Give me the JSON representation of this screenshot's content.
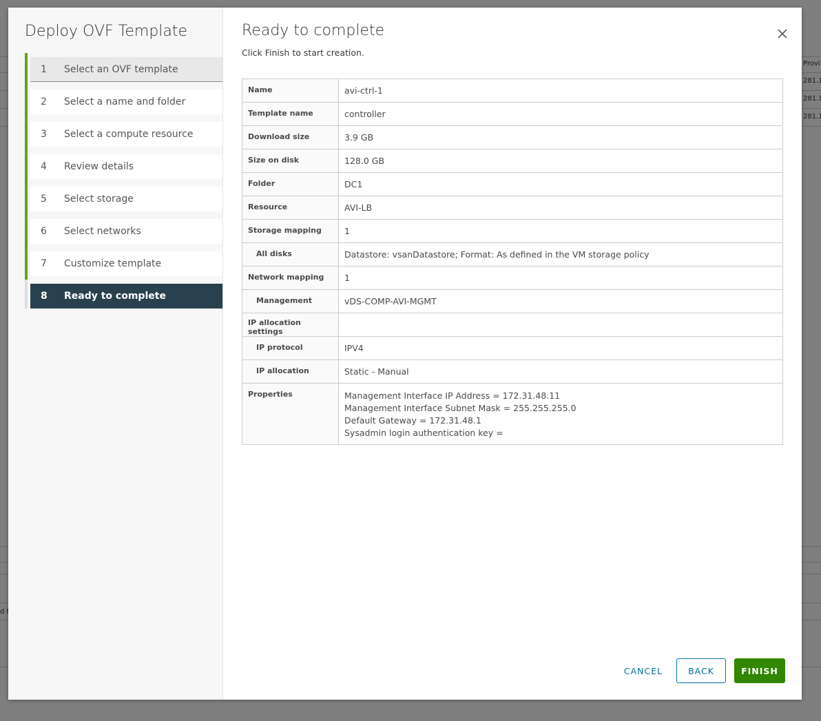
{
  "background": {
    "column_header": "Provi",
    "cells": [
      "281.1",
      "281.1",
      "281.1"
    ],
    "lower_text": "d F"
  },
  "wizard": {
    "title": "Deploy OVF Template",
    "steps": [
      {
        "num": "1",
        "label": "Select an OVF template"
      },
      {
        "num": "2",
        "label": "Select a name and folder"
      },
      {
        "num": "3",
        "label": "Select a compute resource"
      },
      {
        "num": "4",
        "label": "Review details"
      },
      {
        "num": "5",
        "label": "Select storage"
      },
      {
        "num": "6",
        "label": "Select networks"
      },
      {
        "num": "7",
        "label": "Customize template"
      },
      {
        "num": "8",
        "label": "Ready to complete"
      }
    ],
    "active_step": 8,
    "accent_color": "#62a420",
    "active_bg": "#29414e"
  },
  "page": {
    "title": "Ready to complete",
    "subtitle": "Click Finish to start creation.",
    "close_icon": "close-icon"
  },
  "summary": [
    {
      "key": "Name",
      "value": "avi-ctrl-1"
    },
    {
      "key": "Template name",
      "value": "controller"
    },
    {
      "key": "Download size",
      "value": "3.9 GB"
    },
    {
      "key": "Size on disk",
      "value": "128.0 GB"
    },
    {
      "key": "Folder",
      "value": "DC1"
    },
    {
      "key": "Resource",
      "value": "AVI-LB"
    },
    {
      "key": "Storage mapping",
      "value": "1"
    },
    {
      "key": "All disks",
      "value": "Datastore: vsanDatastore; Format: As defined in the VM storage policy"
    },
    {
      "key": "Network mapping",
      "value": "1"
    },
    {
      "key": "Management",
      "value": "vDS-COMP-AVI-MGMT"
    },
    {
      "key": "IP allocation settings",
      "value": ""
    },
    {
      "key": "IP protocol",
      "value": "IPV4"
    },
    {
      "key": "IP allocation",
      "value": "Static - Manual"
    },
    {
      "key": "Properties",
      "lines": [
        "Management Interface IP Address = 172.31.48.11",
        "Management Interface Subnet Mask = 255.255.255.0",
        "Default Gateway = 172.31.48.1",
        "Sysadmin login authentication key ="
      ]
    }
  ],
  "buttons": {
    "cancel": "CANCEL",
    "back": "BACK",
    "finish": "FINISH"
  },
  "colors": {
    "primary": "#0072a3",
    "success": "#318700"
  }
}
